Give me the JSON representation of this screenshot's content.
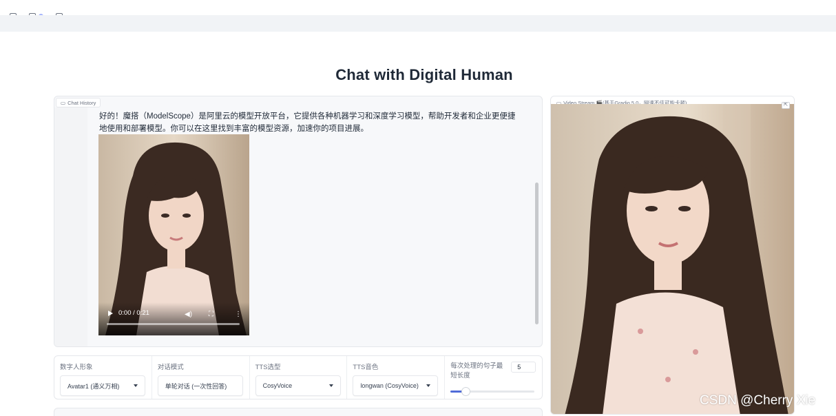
{
  "page": {
    "title": "Chat with Digital Human"
  },
  "chat": {
    "panel_label": "Chat History",
    "message_text": "好的！魔搭（ModelScope）是阿里云的模型开放平台，它提供各种机器学习和深度学习模型，帮助开发者和企业更便捷地使用和部署模型。你可以在这里找到丰富的模型资源，加速你的项目进展。",
    "video_time": "0:00 / 0:21"
  },
  "video_stream": {
    "label": "Video Stream 🎬(基于Gradio 5.0，网速不佳可能卡顿)"
  },
  "controls": {
    "avatar": {
      "label": "数字人形象",
      "value": "Avatar1 (通义万相)"
    },
    "mode": {
      "label": "对话模式",
      "value": "单轮对话 (一次性回答)"
    },
    "tts_model": {
      "label": "TTS选型",
      "value": "CosyVoice"
    },
    "tts_voice": {
      "label": "TTS音色",
      "value": "longwan (CosyVoice)"
    },
    "sentence_length": {
      "label": "每次处理的句子最短长度",
      "value": "5",
      "slider_fraction": 0.18
    }
  },
  "watermark": "CSDN @Cherry Xie",
  "colors": {
    "accent": "#4f6bd8"
  }
}
